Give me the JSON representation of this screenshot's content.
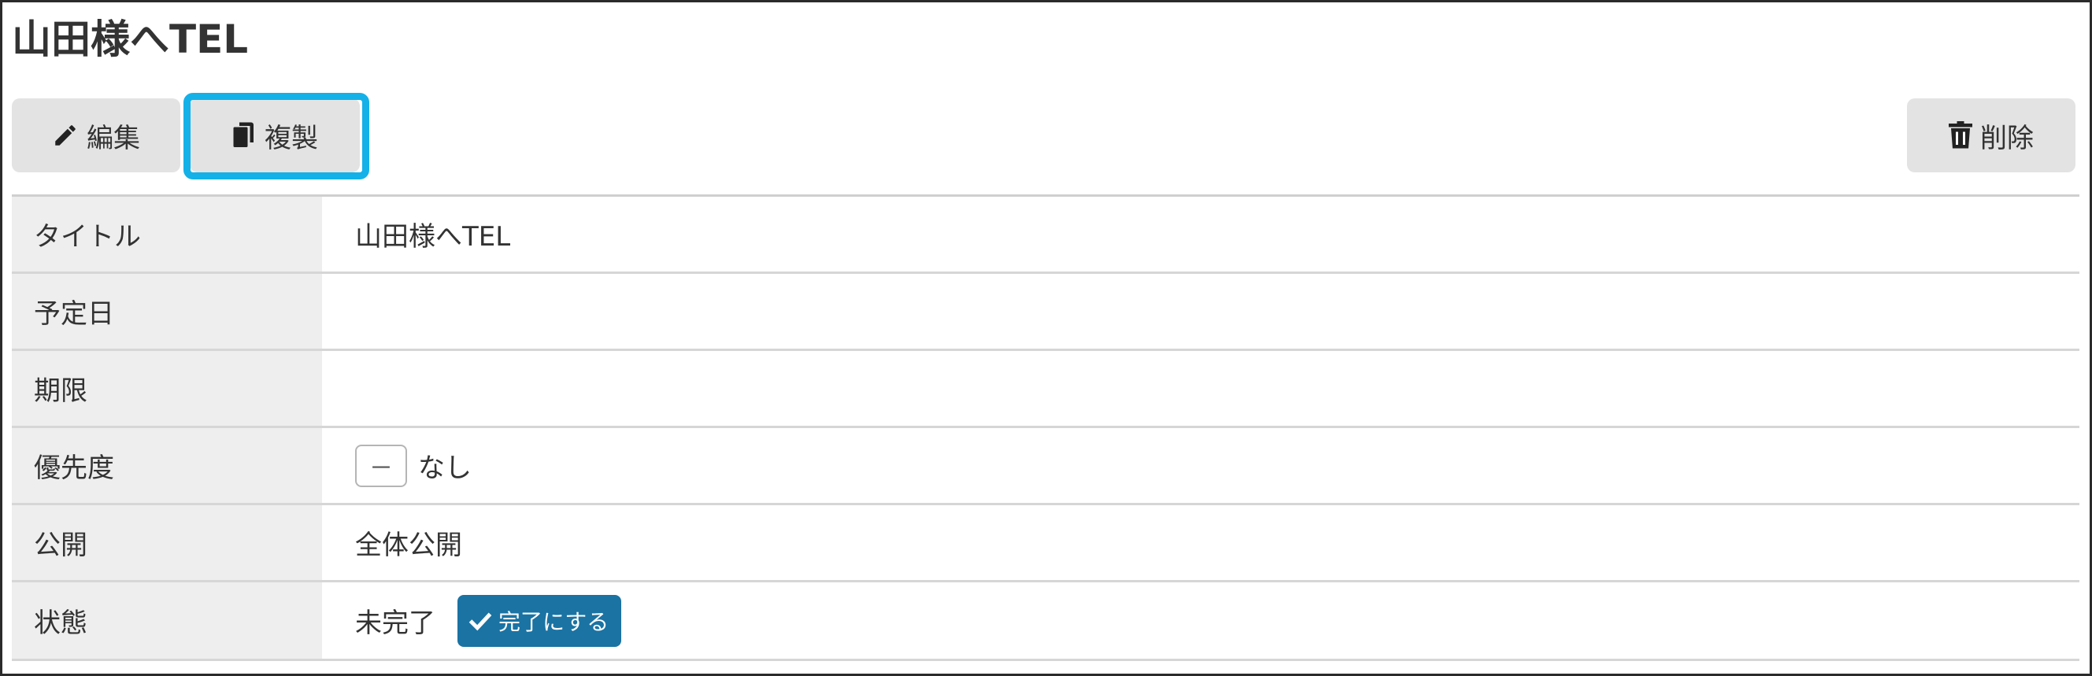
{
  "header": {
    "title": "山田様へTEL"
  },
  "toolbar": {
    "edit_label": "編集",
    "duplicate_label": "複製",
    "delete_label": "削除",
    "highlight_color": "#14b1e8"
  },
  "details": {
    "rows": [
      {
        "label": "タイトル",
        "value": "山田様へTEL"
      },
      {
        "label": "予定日",
        "value": ""
      },
      {
        "label": "期限",
        "value": ""
      },
      {
        "label": "優先度",
        "badge": "－",
        "value": "なし"
      },
      {
        "label": "公開",
        "value": "全体公開"
      },
      {
        "label": "状態",
        "value": "未完了",
        "action_label": "完了にする"
      }
    ]
  },
  "colors": {
    "button_bg": "#e3e3e3",
    "label_bg": "#eeeeee",
    "complete_button": "#1a73a3"
  },
  "icons": {
    "edit": "pencil-icon",
    "duplicate": "copy-icon",
    "delete": "trash-icon",
    "complete": "check-icon"
  }
}
